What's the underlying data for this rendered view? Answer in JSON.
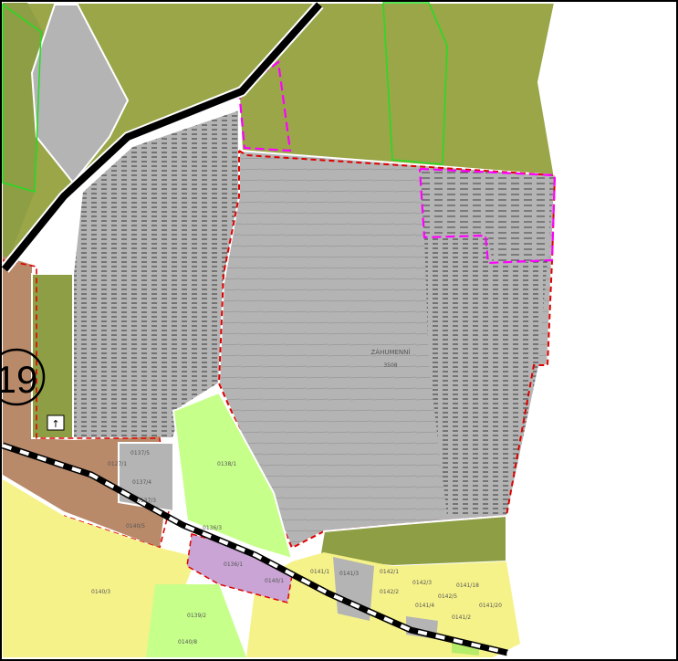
{
  "map": {
    "zone_number": "19",
    "locality_label": "ZÁHUMENNÍ",
    "locality_sub": "3508",
    "parcels": {
      "p1": "0138/1",
      "p2": "0137/5",
      "p3": "0137/4",
      "p4": "0137/3",
      "p5": "0127/1",
      "p6": "0136/3",
      "p7": "0140/5",
      "p8": "0136/1",
      "p9": "0140/1",
      "p10": "0141/1",
      "p11": "0141/3",
      "p12": "0142/1",
      "p13": "0142/2",
      "p14": "0142/3",
      "p15": "0141/18",
      "p16": "0141/20",
      "p17": "0141/2",
      "p18": "0140/8",
      "p19": "0139/2",
      "p20": "0140/3",
      "p21": "0141/4",
      "p22": "0142/5"
    },
    "colors": {
      "agricultural": "#9aa648",
      "garden_green": "#8e9e44",
      "built_area": "#b4b4b4",
      "meadow_light": "#c6ff8a",
      "residential_yellow": "#f6f28a",
      "brown_zone": "#b98a6a",
      "purple_zone": "#c9a4d4",
      "pink_outline": "#ff00ff",
      "red_outline": "#e00000",
      "green_outline": "#22dd22"
    },
    "icons": [
      "symbol-box-icon",
      "zone-circle-icon"
    ]
  }
}
